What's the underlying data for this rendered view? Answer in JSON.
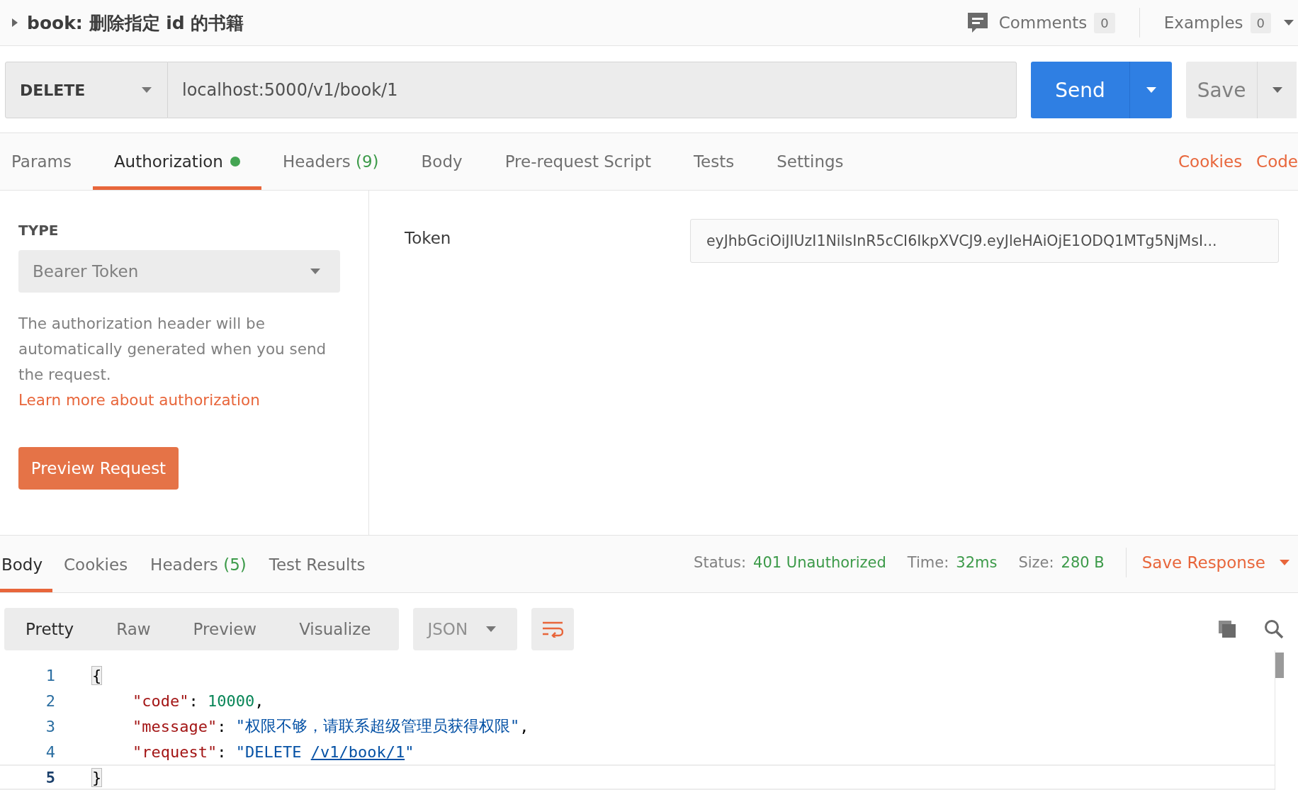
{
  "request_header": {
    "title": "book: 删除指定 id 的书籍",
    "expanded": false,
    "comments": {
      "label": "Comments",
      "count": "0"
    },
    "examples": {
      "label": "Examples",
      "count": "0"
    }
  },
  "url_bar": {
    "method": "DELETE",
    "url": "localhost:5000/v1/book/1",
    "send": "Send",
    "save": "Save"
  },
  "request_tabs": [
    {
      "label": "Params",
      "selected": false,
      "indicator": false
    },
    {
      "label": "Authorization",
      "selected": true,
      "indicator": true
    },
    {
      "label": "Headers",
      "count": "(9)",
      "selected": false,
      "indicator": false
    },
    {
      "label": "Body",
      "selected": false,
      "indicator": false
    },
    {
      "label": "Pre-request Script",
      "selected": false,
      "indicator": false
    },
    {
      "label": "Tests",
      "selected": false,
      "indicator": false
    },
    {
      "label": "Settings",
      "selected": false,
      "indicator": false
    }
  ],
  "request_links": [
    "Cookies",
    "Code"
  ],
  "auth": {
    "type_label": "TYPE",
    "type": "Bearer Token",
    "description": "The authorization header will be automatically generated when you send the request.",
    "link": "Learn more about authorization",
    "preview_button": "Preview Request",
    "token_label": "Token",
    "token": "eyJhbGciOiJIUzI1NiIsInR5cCI6IkpXVCJ9.eyJleHAiOjE1ODQ1MTg5NjMsI..."
  },
  "response_tabs": [
    {
      "label": "Body",
      "selected": true
    },
    {
      "label": "Cookies",
      "selected": false
    },
    {
      "label": "Headers",
      "count": "(5)",
      "selected": false
    },
    {
      "label": "Test Results",
      "selected": false
    }
  ],
  "response_meta": [
    {
      "label": "Status:",
      "value": "401 Unauthorized"
    },
    {
      "label": "Time:",
      "value": "32ms"
    },
    {
      "label": "Size:",
      "value": "280 B"
    }
  ],
  "save_response": "Save Response",
  "format_tabs": [
    {
      "label": "Pretty",
      "selected": true
    },
    {
      "label": "Raw",
      "selected": false
    },
    {
      "label": "Preview",
      "selected": false
    },
    {
      "label": "Visualize",
      "selected": false
    }
  ],
  "language": "JSON",
  "wrap_lines": true,
  "code_lines": [
    {
      "number": "1",
      "selected": false,
      "tokens": [
        {
          "kind": "bracket",
          "text": "{"
        }
      ]
    },
    {
      "number": "2",
      "selected": false,
      "indent": true,
      "tokens": [
        {
          "kind": "key",
          "text": "\"code\""
        },
        {
          "kind": "punct",
          "text": ": "
        },
        {
          "kind": "number",
          "text": "10000"
        },
        {
          "kind": "punct",
          "text": ","
        }
      ]
    },
    {
      "number": "3",
      "selected": false,
      "indent": true,
      "tokens": [
        {
          "kind": "key",
          "text": "\"message\""
        },
        {
          "kind": "punct",
          "text": ": "
        },
        {
          "kind": "string",
          "text": "\"权限不够，请联系超级管理员获得权限\""
        },
        {
          "kind": "punct",
          "text": ","
        }
      ]
    },
    {
      "number": "4",
      "selected": false,
      "indent": true,
      "tokens": [
        {
          "kind": "key",
          "text": "\"request\""
        },
        {
          "kind": "punct",
          "text": ": "
        },
        {
          "kind": "string",
          "text": "\"DELETE "
        },
        {
          "kind": "link",
          "text": "/v1/book/1"
        },
        {
          "kind": "string",
          "text": "\""
        }
      ]
    },
    {
      "number": "5",
      "selected": true,
      "tokens": [
        {
          "kind": "bracket",
          "text": "}"
        }
      ]
    }
  ]
}
